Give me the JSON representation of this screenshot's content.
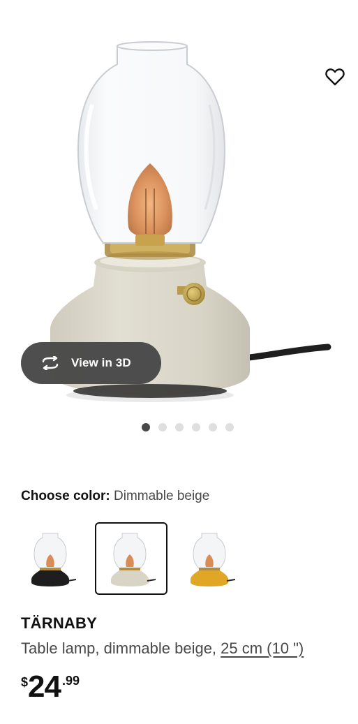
{
  "hero": {
    "image_alt": "TÄRNABY table lamp, dimmable beige",
    "favorite_icon": "heart-outline-icon",
    "view3d_label": "View in 3D",
    "view3d_icon": "rotate-arrows-icon",
    "carousel": {
      "total": 6,
      "active_index": 0
    }
  },
  "color_picker": {
    "label": "Choose color:",
    "selected_value": "Dimmable beige",
    "options": [
      {
        "name": "black",
        "color": "#1e1e1e",
        "selected": false
      },
      {
        "name": "dimmable beige",
        "color": "#d9d5c6",
        "selected": true
      },
      {
        "name": "yellow",
        "color": "#e0a626",
        "selected": false
      }
    ]
  },
  "product": {
    "name": "TÄRNABY",
    "description": "Table lamp, dimmable beige, ",
    "size_link": "25 cm (10 \")"
  },
  "price": {
    "currency": "$",
    "integer": "24",
    "decimal": ".99"
  },
  "colors": {
    "text_primary": "#111111",
    "text_secondary": "#484848",
    "pill_bg": "#484848",
    "dot_active": "#484848",
    "dot_inactive": "#dfdfdf"
  }
}
